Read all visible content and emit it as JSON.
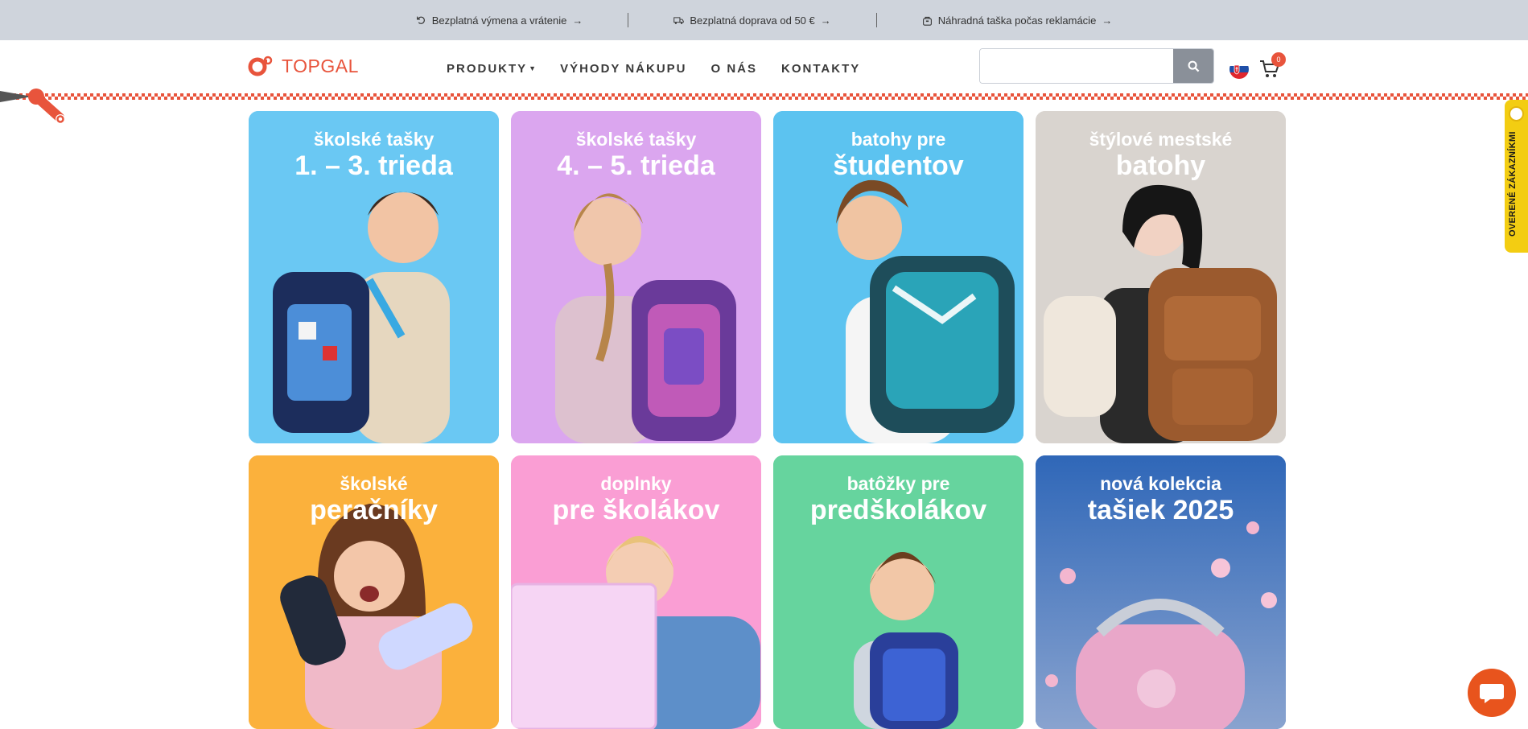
{
  "topbar": {
    "items": [
      {
        "icon": "return-icon",
        "label": "Bezplatná výmena a vrátenie"
      },
      {
        "icon": "truck-icon",
        "label": "Bezplatná doprava od 50 €"
      },
      {
        "icon": "bag-icon",
        "label": "Náhradná taška počas reklamácie"
      }
    ]
  },
  "header": {
    "logo_text": "TOPGAL",
    "nav": [
      "PRODUKTY",
      "VÝHODY NÁKUPU",
      "O NÁS",
      "KONTAKTY"
    ],
    "search_placeholder": "",
    "cart_count": "0"
  },
  "categories": [
    {
      "line1": "školské tašky",
      "line2": "1. – 3. trieda",
      "bg": "#5ec4f2"
    },
    {
      "line1": "školské tašky",
      "line2": "4. – 5. trieda",
      "bg": "#d9a2ee"
    },
    {
      "line1": "batohy pre",
      "line2": "študentov",
      "bg": "#59c2f0"
    },
    {
      "line1": "štýlové mestské",
      "line2": "batohy",
      "bg": "#d7d2cd"
    },
    {
      "line1": "školské",
      "line2": "peračníky",
      "bg": "#fbb03a"
    },
    {
      "line1": "doplnky",
      "line2": "pre školákov",
      "bg": "#f99bd3"
    },
    {
      "line1": "batôžky pre",
      "line2": "predškolákov",
      "bg": "#63d39b"
    },
    {
      "line1": "nová kolekcia",
      "line2": "tašiek 2025",
      "bg": "#3b6bb0"
    }
  ],
  "side_badge": {
    "label": "OVERENÉ ZÁKAZNÍKMI"
  },
  "colors": {
    "brand": "#e8543c",
    "topbar": "#cfd4dc",
    "badge": "#f3cd12"
  }
}
